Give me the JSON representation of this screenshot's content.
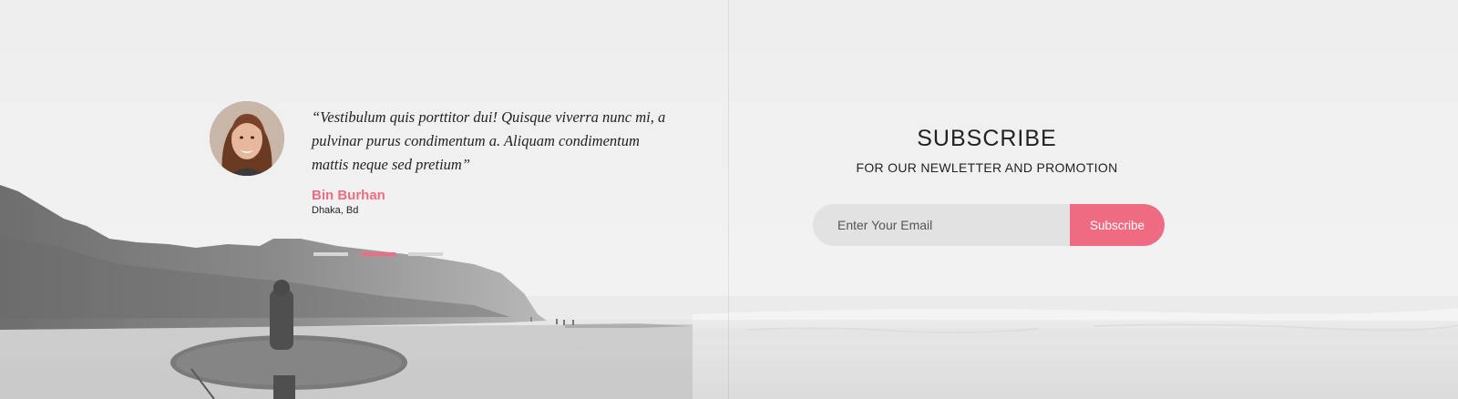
{
  "testimonial": {
    "quote": "“Vestibulum quis porttitor dui! Quisque viverra nunc mi, a pulvinar purus condimentum a. Aliquam condimentum mattis neque sed pretium”",
    "author_name": "Bin Burhan",
    "author_location": "Dhaka, Bd",
    "slider": {
      "count": 3,
      "active_index": 1
    }
  },
  "subscribe": {
    "title": "SUBSCRIBE",
    "subtitle": "FOR OUR NEWLETTER AND PROMOTION",
    "email_placeholder": "Enter Your Email",
    "button_label": "Subscribe"
  },
  "colors": {
    "accent": "#ef6b82",
    "input_bg": "#e2e2e2",
    "text": "#222222"
  }
}
